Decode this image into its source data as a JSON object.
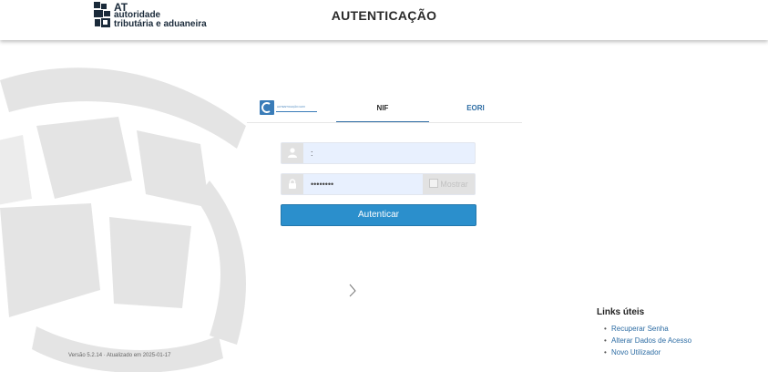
{
  "header": {
    "logo": {
      "abbr": "AT",
      "line1": "autoridade",
      "line2": "tributária e aduaneira"
    },
    "title": "AUTENTICAÇÃO"
  },
  "tabs": {
    "items": [
      {
        "label": "AUTENTICAÇÃO.GOV",
        "icon": "cartao-de-cidadao-logo"
      },
      {
        "label": "NIF",
        "active": true
      },
      {
        "label": "EORI"
      }
    ]
  },
  "form": {
    "username": {
      "value": ":",
      "icon": "user-icon"
    },
    "password": {
      "value": "••••••••",
      "icon": "lock-icon"
    },
    "show_password_label": "Mostrar",
    "submit_label": "Autenticar"
  },
  "links": {
    "title": "Links úteis",
    "items": [
      "Recuperar Senha",
      "Alterar Dados de Acesso",
      "Novo Utilizador"
    ]
  },
  "footer": {
    "version": "Versão 5.2.14 · Atualizado em 2025-01-17"
  },
  "colors": {
    "primary": "#2b8fcc",
    "link": "#2e6da4",
    "watermark": "#e6e6e6",
    "input_bg": "#e8f0fe"
  }
}
